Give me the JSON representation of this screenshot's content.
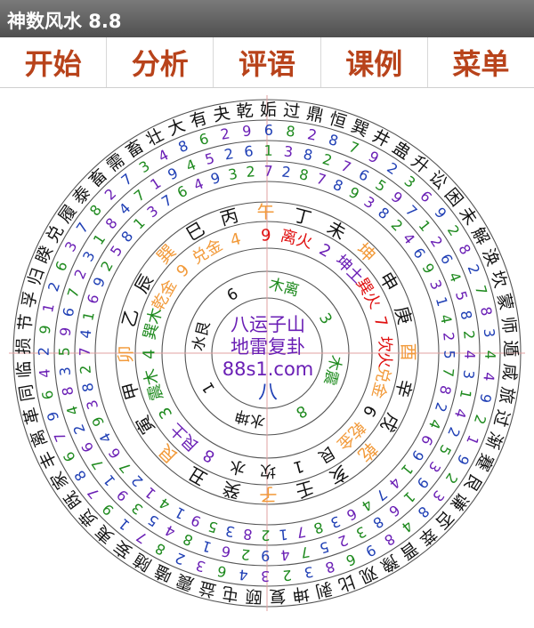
{
  "app": {
    "title": "神数风水 8.8"
  },
  "menu": [
    {
      "id": "start",
      "label": "开始"
    },
    {
      "id": "analyze",
      "label": "分析"
    },
    {
      "id": "review",
      "label": "评语"
    },
    {
      "id": "cases",
      "label": "课例"
    },
    {
      "id": "menu",
      "label": "菜单"
    }
  ],
  "colors": {
    "accent": "#b8431b",
    "ring": "#555555",
    "axis": "#e0a0a0",
    "purple": "#6a1fb5",
    "blue": "#1f3fb5",
    "green": "#1e8a1e",
    "red": "#e01010",
    "orange": "#f29a3a",
    "black": "#111111"
  },
  "center": {
    "line1": "八运子山",
    "line2": "地雷复卦",
    "site": "88s1.com",
    "bagua": "八"
  },
  "gua_names": [
    "乾",
    "姤",
    "过",
    "鼎",
    "恒",
    "巽",
    "井",
    "蛊",
    "升",
    "讼",
    "困",
    "未",
    "解",
    "涣",
    "坎",
    "蒙",
    "师",
    "遁",
    "咸",
    "旅",
    "过",
    "渐",
    "蹇",
    "艮",
    "谦",
    "否",
    "萃",
    "晋",
    "豫",
    "观",
    "比",
    "剥",
    "坤",
    "复",
    "颐",
    "屯",
    "益",
    "震",
    "嗑",
    "随",
    "妄",
    "夷",
    "贲",
    "既",
    "家",
    "丰",
    "离",
    "革",
    "同",
    "临",
    "损",
    "节",
    "孚",
    "归",
    "睽",
    "兑",
    "履",
    "泰",
    "畜",
    "需",
    "畜",
    "壮",
    "大",
    "有",
    "夬"
  ],
  "ring1": [
    "9",
    "6",
    "8",
    "2",
    "8",
    "7",
    "9",
    "2",
    "3",
    "6",
    "9",
    "2",
    "8",
    "2",
    "7",
    "8",
    "3",
    "4",
    "4",
    "9",
    "2",
    "1",
    "9",
    "2",
    "3",
    "8",
    "4",
    "8",
    "9",
    "6",
    "8",
    "3",
    "2",
    "3",
    "4",
    "6",
    "3",
    "2",
    "8",
    "7",
    "1",
    "9",
    "7",
    "8",
    "6",
    "7",
    "9",
    "6",
    "4",
    "2",
    "9",
    "1",
    "2",
    "6",
    "3",
    "7",
    "8",
    "2",
    "7",
    "3",
    "4",
    "8",
    "6",
    "2"
  ],
  "ring2": [
    "6",
    "1",
    "3",
    "8",
    "2",
    "7",
    "6",
    "5",
    "9",
    "7",
    "1",
    "2",
    "6",
    "4",
    "5",
    "8",
    "2",
    "4",
    "3",
    "1",
    "4",
    "2",
    "5",
    "3",
    "9",
    "1",
    "6",
    "8",
    "3",
    "2",
    "5",
    "7",
    "4",
    "9",
    "2",
    "6",
    "1",
    "8",
    "4",
    "5",
    "3",
    "9",
    "1",
    "7",
    "6",
    "2",
    "4",
    "8",
    "3",
    "5",
    "9",
    "6",
    "7",
    "2",
    "3",
    "1",
    "8",
    "4",
    "7",
    "1",
    "9",
    "4",
    "5",
    "2"
  ],
  "ring3": [
    "2",
    "7",
    "2",
    "8",
    "7",
    "8",
    "9",
    "3",
    "8",
    "2",
    "4",
    "6",
    "9",
    "3",
    "1",
    "4",
    "2",
    "5",
    "7",
    "8",
    "2",
    "4",
    "6",
    "9",
    "1",
    "4",
    "7",
    "4",
    "6",
    "3",
    "8",
    "7",
    "1",
    "2",
    "8",
    "3",
    "5",
    "9",
    "1",
    "4",
    "1",
    "2",
    "7",
    "6",
    "4",
    "9",
    "3",
    "8",
    "2",
    "7",
    "4",
    "1",
    "6",
    "9",
    "2",
    "5",
    "8",
    "1",
    "3",
    "7",
    "6",
    "4",
    "9",
    "3"
  ],
  "mountains": [
    "午",
    "丁",
    "未",
    "坤",
    "申",
    "庚",
    "酉",
    "辛",
    "戌",
    "乾",
    "亥",
    "壬",
    "子",
    "癸",
    "丑",
    "艮",
    "寅",
    "甲",
    "卯",
    "乙",
    "辰",
    "巽",
    "巳",
    "丙"
  ],
  "stars": [
    {
      "d": "9",
      "c": "red"
    },
    {
      "d": "离火",
      "c": "red"
    },
    {
      "d": "2",
      "c": "purple"
    },
    {
      "d": "坤土",
      "c": "purple"
    },
    {
      "d": "巽火",
      "c": "red"
    },
    {
      "d": "7",
      "c": "red"
    },
    {
      "d": "坎火",
      "c": "red"
    },
    {
      "d": "兑金",
      "c": "orange"
    },
    {
      "d": "6",
      "c": "black"
    },
    {
      "d": "乾金",
      "c": "orange"
    },
    {
      "d": "艮",
      "c": "black"
    },
    {
      "d": "1",
      "c": "black"
    },
    {
      "d": "坎",
      "c": "black"
    },
    {
      "d": "水",
      "c": "black"
    },
    {
      "d": "8",
      "c": "purple"
    },
    {
      "d": "艮土",
      "c": "purple"
    },
    {
      "d": "3",
      "c": "green"
    },
    {
      "d": "震木",
      "c": "green"
    },
    {
      "d": "4",
      "c": "green"
    },
    {
      "d": "巽木",
      "c": "green"
    },
    {
      "d": "乾金",
      "c": "orange"
    },
    {
      "d": "9",
      "c": "orange"
    },
    {
      "d": "兑金",
      "c": "orange"
    },
    {
      "d": "4",
      "c": "orange"
    }
  ],
  "inner": [
    {
      "d": "木离",
      "c": "green"
    },
    {
      "d": "3",
      "c": "green"
    },
    {
      "d": "木震",
      "c": "green"
    },
    {
      "d": "8",
      "c": "green"
    },
    {
      "d": "水坤",
      "c": "black"
    },
    {
      "d": "1",
      "c": "black"
    },
    {
      "d": "水艮",
      "c": "black"
    },
    {
      "d": "6",
      "c": "black"
    }
  ]
}
